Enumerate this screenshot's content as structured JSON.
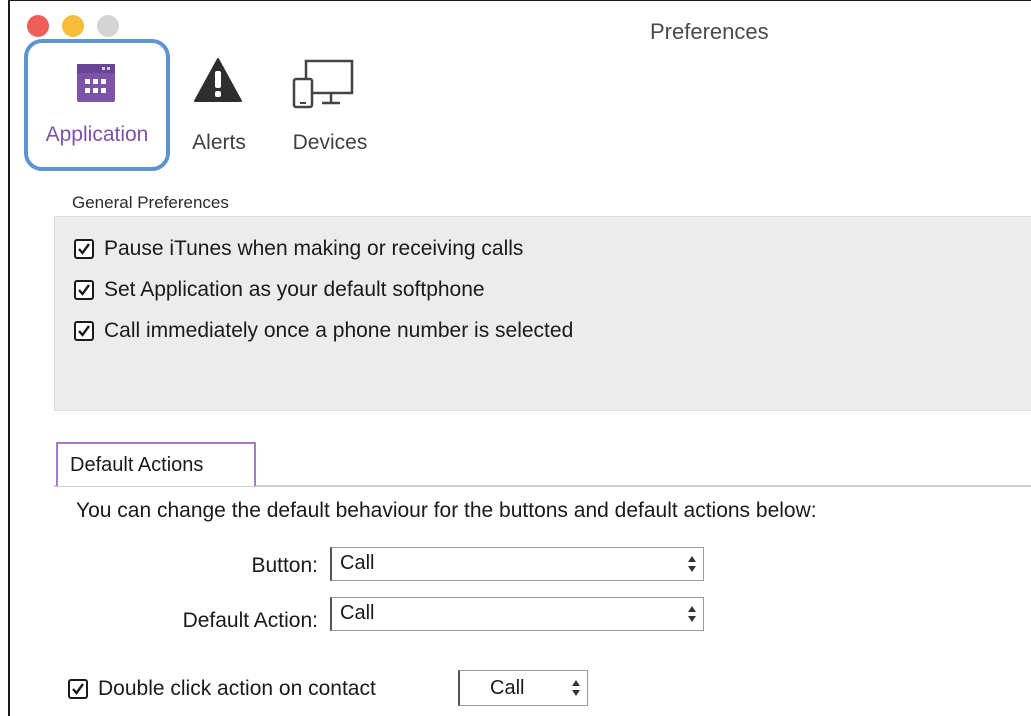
{
  "window": {
    "title": "Preferences"
  },
  "toolbar": {
    "items": [
      {
        "label": "Application",
        "icon": "calendar-icon"
      },
      {
        "label": "Alerts",
        "icon": "warning-icon"
      },
      {
        "label": "Devices",
        "icon": "devices-icon"
      }
    ]
  },
  "general": {
    "title": "General Preferences",
    "options": [
      {
        "label": "Pause iTunes when making or receiving calls",
        "checked": true
      },
      {
        "label": "Set Application as your default softphone",
        "checked": true
      },
      {
        "label": "Call immediately once a phone number is selected",
        "checked": true
      }
    ]
  },
  "default_actions": {
    "tab_label": "Default Actions",
    "description": "You can change the default behaviour for the buttons and default actions below:",
    "button_label": "Button:",
    "button_value": "Call",
    "default_action_label": "Default Action:",
    "default_action_value": "Call",
    "double_click_label": "Double click action on contact",
    "double_click_checked": true,
    "double_click_value": "Call"
  },
  "colors": {
    "accent_purple": "#7c53a8",
    "focus_ring": "#5e95d0",
    "close": "#ee5f57",
    "minimize": "#f5bd3a",
    "zoom": "#d4d4d4"
  }
}
